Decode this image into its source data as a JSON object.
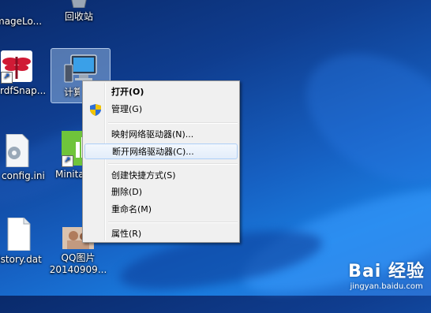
{
  "desktop": {
    "icons": [
      {
        "label": "mageLo..."
      },
      {
        "label": "回收站"
      },
      {
        "label": "rdfSnap..."
      },
      {
        "label": "计算机"
      },
      {
        "label": "config.ini"
      },
      {
        "label": "Minita..."
      },
      {
        "label": "listory.dat"
      },
      {
        "label": "QQ图片\n20140909..."
      }
    ]
  },
  "context_menu": {
    "items": [
      {
        "label": "打开(O)"
      },
      {
        "label": "管理(G)"
      },
      {
        "label": "映射网络驱动器(N)..."
      },
      {
        "label": "断开网络驱动器(C)..."
      },
      {
        "label": "创建快捷方式(S)"
      },
      {
        "label": "删除(D)"
      },
      {
        "label": "重命名(M)"
      },
      {
        "label": "属性(R)"
      }
    ]
  },
  "watermark": {
    "logo": "Bai 经验",
    "url": "jingyan.baidu.com"
  }
}
